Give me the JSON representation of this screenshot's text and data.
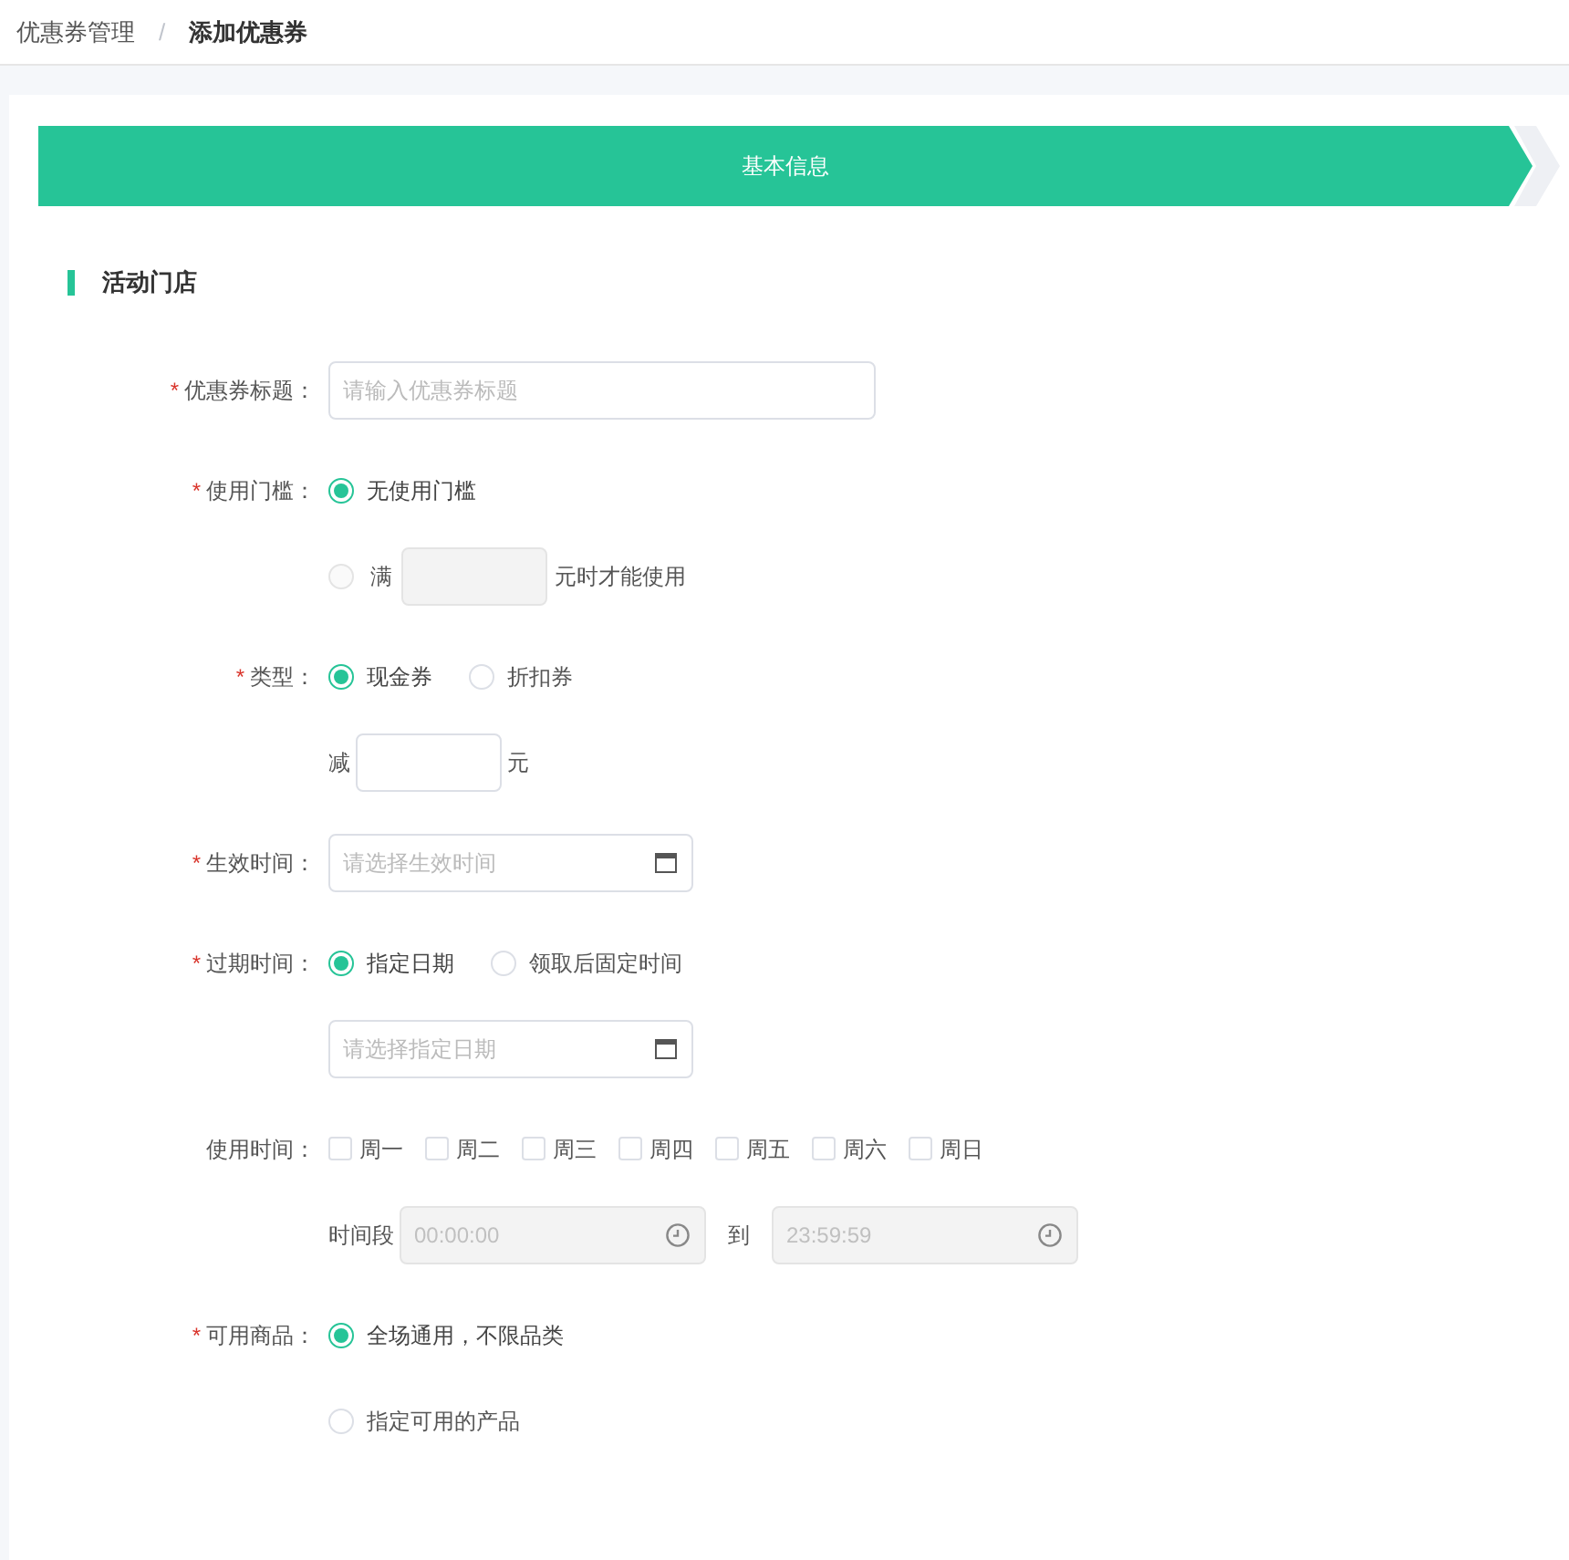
{
  "breadcrumb": [
    {
      "label": "优惠券管理",
      "current": false
    },
    {
      "label": "添加优惠券",
      "current": true
    }
  ],
  "breadcrumb_separator": "/",
  "steps": [
    {
      "label": "基本信息",
      "selected": true
    },
    {
      "selected": false
    }
  ],
  "section": {
    "title": "活动门店"
  },
  "fields": [
    {
      "label": "优惠券标题：",
      "required_mark": "*",
      "rows": [
        {
          "kind": "input",
          "placeholder": "请输入优惠券标题"
        }
      ]
    },
    {
      "label": "使用门槛：",
      "required_mark": "*",
      "rows": [
        {
          "kind": "radios",
          "options": [
            {
              "label": "无使用门槛",
              "selected": true
            }
          ]
        },
        {
          "kind": "radio-amount",
          "prefix": "满",
          "suffix": "元时才能使用",
          "selected": false,
          "disabled": true
        }
      ]
    },
    {
      "label": "类型：",
      "required_mark": "*",
      "rows": [
        {
          "kind": "radios",
          "options": [
            {
              "label": "现金券",
              "selected": true
            },
            {
              "label": "折扣券",
              "selected": false
            }
          ]
        },
        {
          "kind": "amount",
          "prefix": "减",
          "suffix": "元"
        }
      ]
    },
    {
      "label": "生效时间：",
      "required_mark": "*",
      "rows": [
        {
          "kind": "date",
          "placeholder": "请选择生效时间"
        }
      ]
    },
    {
      "label": "过期时间：",
      "required_mark": "*",
      "rows": [
        {
          "kind": "radios",
          "options": [
            {
              "label": "指定日期",
              "selected": true
            },
            {
              "label": "领取后固定时间",
              "selected": false
            }
          ]
        },
        {
          "kind": "date",
          "placeholder": "请选择指定日期"
        }
      ]
    },
    {
      "label": "使用时间：",
      "rows": [
        {
          "kind": "checkboxes",
          "options": [
            {
              "label": "周一",
              "checked": false
            },
            {
              "label": "周二",
              "checked": false
            },
            {
              "label": "周三",
              "checked": false
            },
            {
              "label": "周四",
              "checked": false
            },
            {
              "label": "周五",
              "checked": false
            },
            {
              "label": "周六",
              "checked": false
            },
            {
              "label": "周日",
              "checked": false
            }
          ]
        },
        {
          "kind": "time-range",
          "prefix": "时间段",
          "start_placeholder": "00:00:00",
          "separator": "到",
          "end_placeholder": "23:59:59",
          "disabled": true
        }
      ]
    },
    {
      "label": "可用商品：",
      "required_mark": "*",
      "rows": [
        {
          "kind": "radios",
          "options": [
            {
              "label": "全场通用，不限品类",
              "selected": true
            }
          ]
        },
        {
          "kind": "radios",
          "options": [
            {
              "label": "指定可用的产品",
              "selected": false
            }
          ]
        }
      ]
    }
  ]
}
